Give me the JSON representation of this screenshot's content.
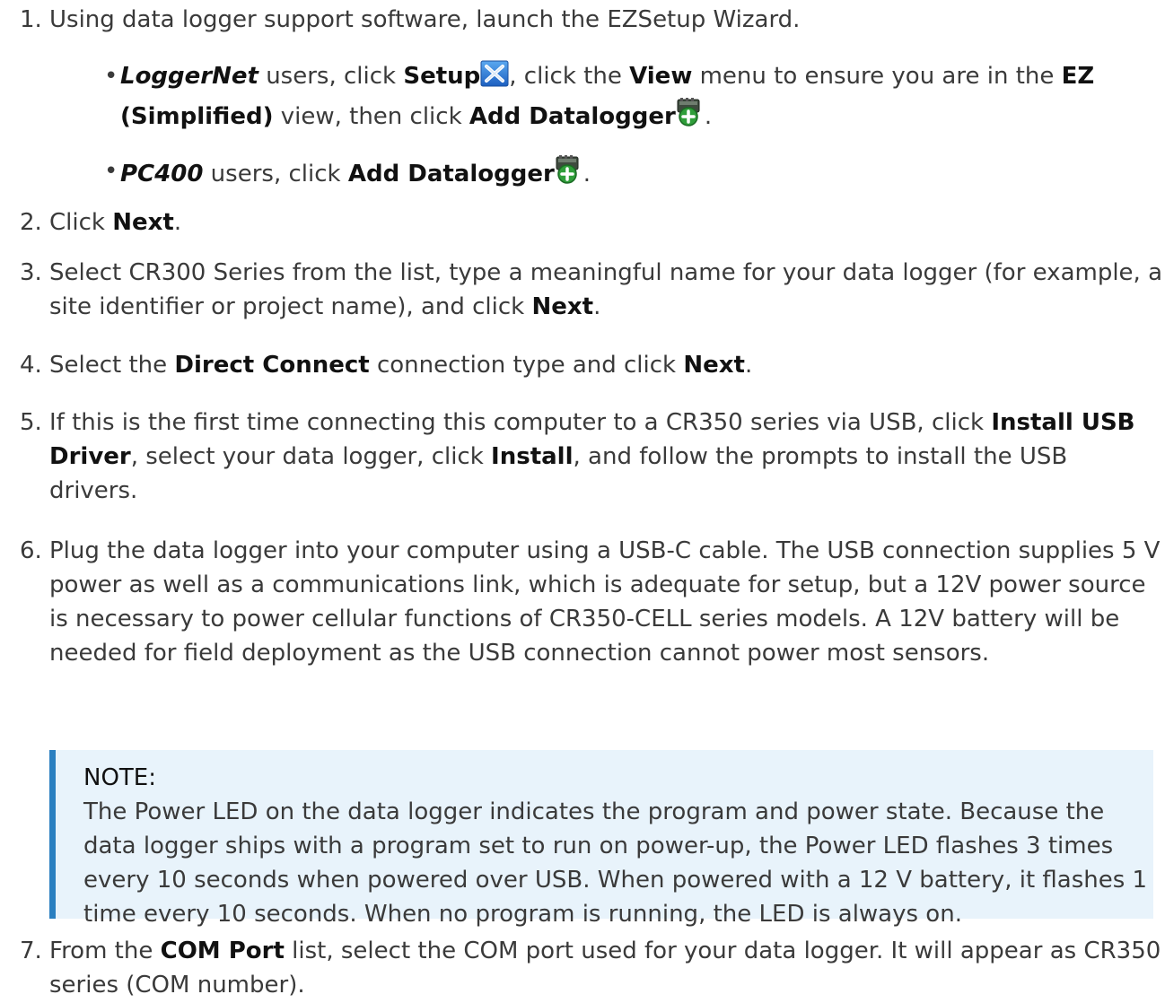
{
  "colors": {
    "text": "#3a3a3a",
    "bold_text": "#111111",
    "note_background": "#e8f3fb",
    "note_border": "#2a7fc0"
  },
  "steps": [
    {
      "num": "1.",
      "text": "Using data logger support software, launch the EZSetup Wizard."
    },
    {
      "num": "2.",
      "pre": "Click ",
      "b1": "Next",
      "post": "."
    },
    {
      "num": "3.",
      "pre": "Select CR300 Series from the list, type a meaningful name for your data logger (for example, a site identifier or project name), and click ",
      "b1": "Next",
      "post": "."
    },
    {
      "num": "4.",
      "pre": "Select the ",
      "b1": "Direct Connect",
      "mid": " connection type and click ",
      "b2": "Next",
      "post": "."
    },
    {
      "num": "5.",
      "pre": "If this is the first time connecting this computer to a CR350 series via USB, click ",
      "b1": "Install USB Driver",
      "mid": ", select your data logger, click ",
      "b2": "Install",
      "post": ", and follow the prompts to install the USB drivers."
    },
    {
      "num": "6.",
      "text": "Plug the data logger into your computer using a USB-C cable. The USB connection supplies 5 V power as well as a communications link, which is adequate for setup, but a 12V power source is necessary to power cellular functions of CR350-CELL series models. A 12V battery will be needed for field deployment as the USB connection cannot power most sensors."
    },
    {
      "num": "7.",
      "pre": "From the ",
      "b1": "COM Port",
      "post": " list, select the COM port used for your data logger. It will appear as CR350 series (COM number)."
    }
  ],
  "bullets": [
    {
      "dot": "•",
      "app": "LoggerNet",
      "t1": " users, click ",
      "b1": "Setup",
      "icon1": "setup-icon",
      "t2": ", click the ",
      "b2": "View",
      "t3": " menu to ensure you are in the ",
      "b3": "EZ (Simplified)",
      "t4": " view, then click ",
      "b4": "Add Datalogger",
      "icon2": "add-datalogger-icon",
      "t5": "."
    },
    {
      "dot": "•",
      "app": "PC400",
      "t1": " users, click ",
      "b1": "Add Datalogger",
      "icon1": "add-datalogger-icon",
      "t2": "."
    }
  ],
  "note": {
    "title": "NOTE:",
    "body": "The Power LED on the data logger indicates the program and power state. Because the data logger ships with a program set to run on power-up, the Power LED flashes 3 times every 10 seconds when powered over USB. When powered with a 12 V battery, it flashes 1 time every 10 seconds. When no program is running, the LED is always on."
  }
}
